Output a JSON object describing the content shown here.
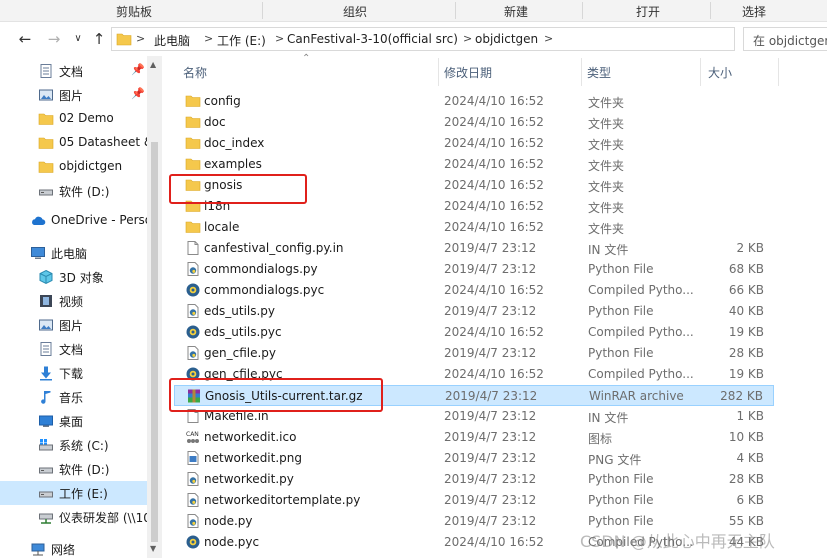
{
  "ribbon": {
    "groups": [
      "剪贴板",
      "组织",
      "新建",
      "打开",
      "选择"
    ]
  },
  "address": {
    "crumbs": [
      "此电脑",
      "工作 (E:)",
      "CanFestival-3-10(official src)",
      "objdictgen"
    ],
    "separator": ">",
    "search_placeholder": "在 objdictgen"
  },
  "nav": {
    "items": [
      {
        "label": "文档",
        "icon": "document-icon",
        "pinned": true
      },
      {
        "label": "图片",
        "icon": "pictures-icon",
        "pinned": true
      },
      {
        "label": "02 Demo",
        "icon": "folder-icon",
        "pinned": false
      },
      {
        "label": "05 Datasheet &",
        "icon": "folder-icon",
        "pinned": false
      },
      {
        "label": "objdictgen",
        "icon": "folder-icon",
        "pinned": false
      },
      {
        "label": "软件 (D:)",
        "icon": "drive-icon",
        "pinned": false
      },
      {
        "label": "OneDrive - Perso",
        "icon": "cloud-icon",
        "pinned": false
      },
      {
        "label": "此电脑",
        "icon": "computer-icon",
        "pinned": false
      },
      {
        "label": "3D 对象",
        "icon": "3d-objects-icon",
        "pinned": false
      },
      {
        "label": "视频",
        "icon": "video-icon",
        "pinned": false
      },
      {
        "label": "图片",
        "icon": "pictures-icon",
        "pinned": false
      },
      {
        "label": "文档",
        "icon": "document-icon",
        "pinned": false
      },
      {
        "label": "下载",
        "icon": "download-icon",
        "pinned": false
      },
      {
        "label": "音乐",
        "icon": "music-icon",
        "pinned": false
      },
      {
        "label": "桌面",
        "icon": "desktop-icon",
        "pinned": false
      },
      {
        "label": "系统 (C:)",
        "icon": "windows-drive-icon",
        "pinned": false
      },
      {
        "label": "软件 (D:)",
        "icon": "drive-icon",
        "pinned": false
      },
      {
        "label": "工作 (E:)",
        "icon": "drive-icon",
        "pinned": false,
        "selected": true
      },
      {
        "label": "仪表研发部 (\\\\10",
        "icon": "network-drive-icon",
        "pinned": false
      },
      {
        "label": "网络",
        "icon": "network-icon",
        "pinned": false
      }
    ]
  },
  "columns": {
    "name": "名称",
    "date": "修改日期",
    "type": "类型",
    "size": "大小"
  },
  "files": [
    {
      "name": "config",
      "date": "2024/4/10 16:52",
      "type": "文件夹",
      "size": "",
      "icon": "folder-icon"
    },
    {
      "name": "doc",
      "date": "2024/4/10 16:52",
      "type": "文件夹",
      "size": "",
      "icon": "folder-icon"
    },
    {
      "name": "doc_index",
      "date": "2024/4/10 16:52",
      "type": "文件夹",
      "size": "",
      "icon": "folder-icon"
    },
    {
      "name": "examples",
      "date": "2024/4/10 16:52",
      "type": "文件夹",
      "size": "",
      "icon": "folder-icon"
    },
    {
      "name": "gnosis",
      "date": "2024/4/10 16:52",
      "type": "文件夹",
      "size": "",
      "icon": "folder-icon"
    },
    {
      "name": "i18n",
      "date": "2024/4/10 16:52",
      "type": "文件夹",
      "size": "",
      "icon": "folder-icon"
    },
    {
      "name": "locale",
      "date": "2024/4/10 16:52",
      "type": "文件夹",
      "size": "",
      "icon": "folder-icon"
    },
    {
      "name": "canfestival_config.py.in",
      "date": "2019/4/7 23:12",
      "type": "IN 文件",
      "size": "2 KB",
      "icon": "blank-file-icon"
    },
    {
      "name": "commondialogs.py",
      "date": "2019/4/7 23:12",
      "type": "Python File",
      "size": "68 KB",
      "icon": "python-file-icon"
    },
    {
      "name": "commondialogs.pyc",
      "date": "2024/4/10 16:52",
      "type": "Compiled Pytho...",
      "size": "66 KB",
      "icon": "python-compiled-icon"
    },
    {
      "name": "eds_utils.py",
      "date": "2019/4/7 23:12",
      "type": "Python File",
      "size": "40 KB",
      "icon": "python-file-icon"
    },
    {
      "name": "eds_utils.pyc",
      "date": "2024/4/10 16:52",
      "type": "Compiled Pytho...",
      "size": "19 KB",
      "icon": "python-compiled-icon"
    },
    {
      "name": "gen_cfile.py",
      "date": "2019/4/7 23:12",
      "type": "Python File",
      "size": "28 KB",
      "icon": "python-file-icon"
    },
    {
      "name": "gen_cfile.pyc",
      "date": "2024/4/10 16:52",
      "type": "Compiled Pytho...",
      "size": "19 KB",
      "icon": "python-compiled-icon"
    },
    {
      "name": "Gnosis_Utils-current.tar.gz",
      "date": "2019/4/7 23:12",
      "type": "WinRAR archive",
      "size": "282 KB",
      "icon": "winrar-archive-icon",
      "selected": true
    },
    {
      "name": "Makefile.in",
      "date": "2019/4/7 23:12",
      "type": "IN 文件",
      "size": "1 KB",
      "icon": "blank-file-icon"
    },
    {
      "name": "networkedit.ico",
      "date": "2019/4/7 23:12",
      "type": "图标",
      "size": "10 KB",
      "icon": "can-ico-icon"
    },
    {
      "name": "networkedit.png",
      "date": "2019/4/7 23:12",
      "type": "PNG 文件",
      "size": "4 KB",
      "icon": "png-file-icon"
    },
    {
      "name": "networkedit.py",
      "date": "2019/4/7 23:12",
      "type": "Python File",
      "size": "28 KB",
      "icon": "python-file-icon"
    },
    {
      "name": "networkeditortemplate.py",
      "date": "2019/4/7 23:12",
      "type": "Python File",
      "size": "6 KB",
      "icon": "python-file-icon"
    },
    {
      "name": "node.py",
      "date": "2019/4/7 23:12",
      "type": "Python File",
      "size": "55 KB",
      "icon": "python-file-icon"
    },
    {
      "name": "node.pyc",
      "date": "2024/4/10 16:52",
      "type": "Compiled Pytho...",
      "size": "44 KB",
      "icon": "python-compiled-icon"
    }
  ],
  "watermark": "CSDN @从此心中再无主队",
  "colors": {
    "selection": "#cce8ff",
    "selection_border": "#99d1ff",
    "highlight_box": "#e0201b",
    "folder": "#f5c84c",
    "header_text": "#4c607a"
  }
}
